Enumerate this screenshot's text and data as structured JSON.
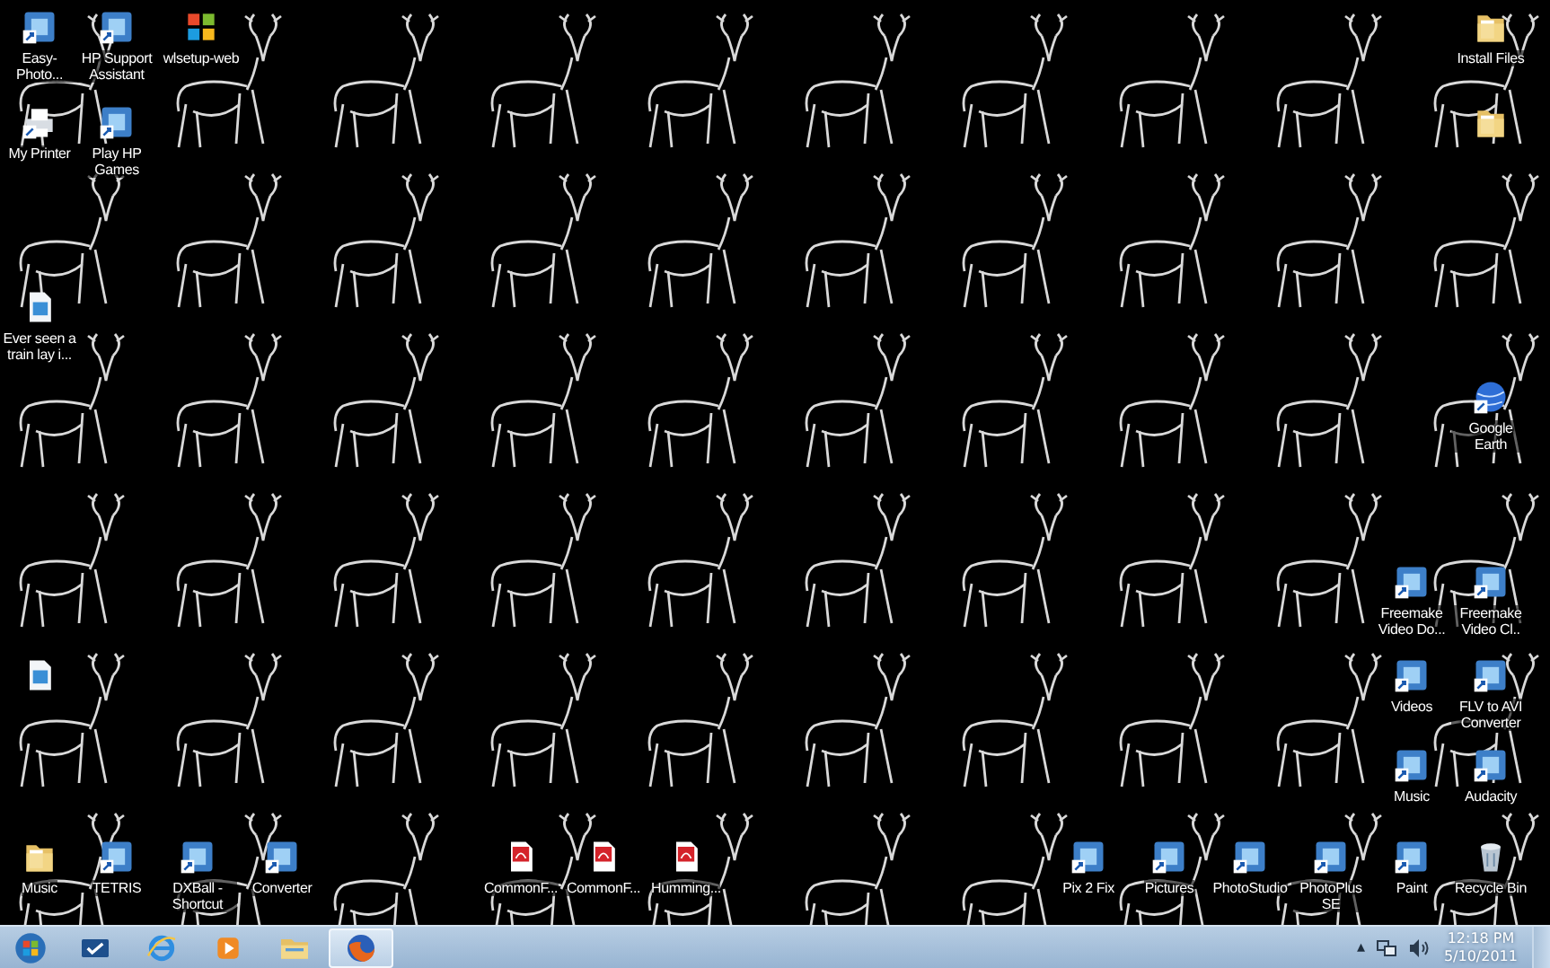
{
  "desktop": {
    "icons": [
      {
        "label": "Easy-Photo...",
        "kind": "app"
      },
      {
        "label": "HP Support Assistant",
        "kind": "app"
      },
      {
        "label": "wlsetup-web",
        "kind": "windows"
      },
      {
        "label": "Install Files",
        "kind": "folder"
      },
      {
        "label": "My Printer",
        "kind": "printer"
      },
      {
        "label": "Play HP Games",
        "kind": "app"
      },
      {
        "kind": "folder"
      },
      {
        "label": "Ever seen a train lay i...",
        "kind": "file"
      },
      {
        "label": "Google Earth",
        "kind": "globe"
      },
      {
        "label": "Freemake Video Do...",
        "kind": "app"
      },
      {
        "label": "Freemake Video Cl..",
        "kind": "app"
      },
      {
        "kind": "file"
      },
      {
        "label": "Videos",
        "kind": "app"
      },
      {
        "label": "FLV to AVI Converter",
        "kind": "app"
      },
      {
        "label": "Music",
        "kind": "app"
      },
      {
        "label": "Audacity",
        "kind": "app"
      },
      {
        "label": "Music",
        "kind": "folder"
      },
      {
        "label": "TETRIS",
        "kind": "app"
      },
      {
        "label": "DXBall - Shortcut",
        "kind": "app"
      },
      {
        "label": "Converter",
        "kind": "app"
      },
      {
        "label": "CommonF...",
        "kind": "pdf"
      },
      {
        "label": "CommonF...",
        "kind": "pdf"
      },
      {
        "label": "Humming...",
        "kind": "pdf"
      },
      {
        "label": "Pix 2 Fix",
        "kind": "app"
      },
      {
        "label": "Pictures",
        "kind": "app"
      },
      {
        "label": "PhotoStudio",
        "kind": "app"
      },
      {
        "label": "PhotoPlus SE",
        "kind": "app"
      },
      {
        "label": "Paint",
        "kind": "app"
      },
      {
        "label": "Recycle Bin",
        "kind": "bin"
      }
    ]
  },
  "taskbar": {
    "items": [
      {
        "kind": "start",
        "selected": false
      },
      {
        "kind": "check",
        "selected": false
      },
      {
        "kind": "browser",
        "selected": false
      },
      {
        "kind": "media",
        "selected": false
      },
      {
        "kind": "folder",
        "selected": false
      },
      {
        "kind": "firefox",
        "selected": true
      }
    ],
    "tray": {
      "overflow": "▴",
      "time": "12:18 PM",
      "date": "5/10/2011"
    }
  }
}
